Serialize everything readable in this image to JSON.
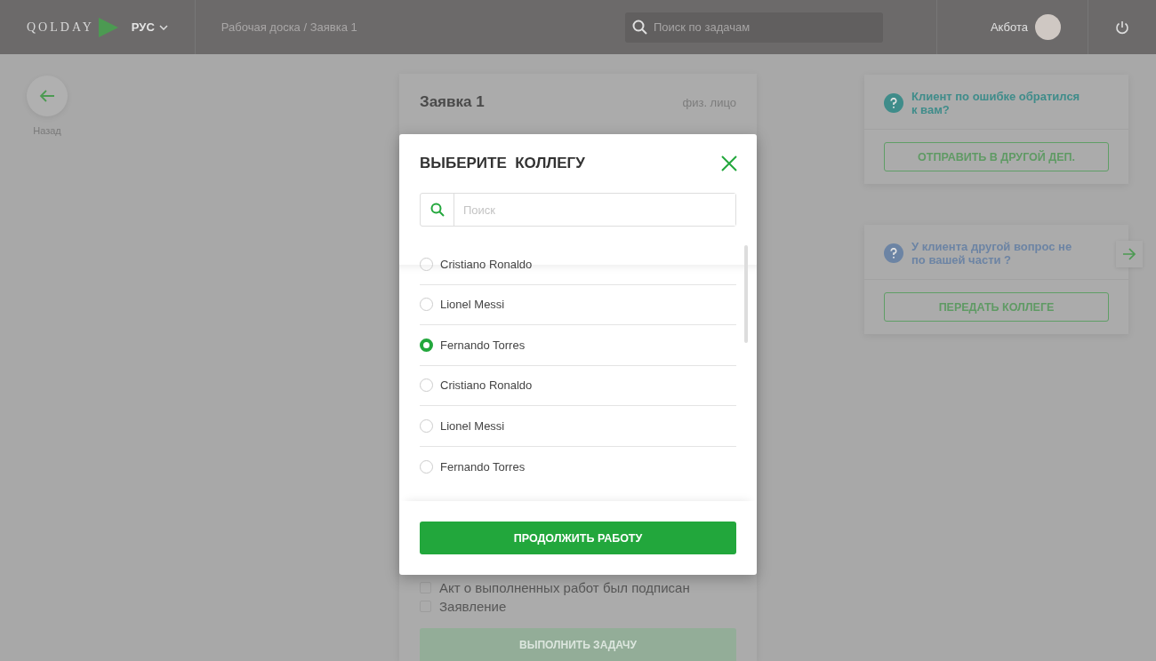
{
  "header": {
    "logo": "QOLDAY",
    "language": "РУС",
    "breadcrumb": "Рабочая доска / Заявка 1",
    "search": {
      "placeholder": "Поиск по задачам"
    },
    "user": "Акбота"
  },
  "back": {
    "label": "Назад"
  },
  "task": {
    "title": "Заявка 1",
    "type": "физ. лицо",
    "checklist": [
      {
        "label": "Акт о выполненных работ был подписан",
        "checked": false
      },
      {
        "label": "Заявление",
        "checked": false
      }
    ],
    "action": {
      "label": "ВЫПОЛНИТЬ ЗАДАЧУ",
      "disabled": true
    }
  },
  "side_cards": [
    {
      "question": "Клиент по ошибке обратился к вам?",
      "button": "ОТПРАВИТЬ В ДРУГОЙ ДЕП.",
      "color": "#3f8c8a",
      "next": false
    },
    {
      "question": "У клиента другой вопрос не по вашей части ?",
      "button": "ПЕРЕДАТЬ КОЛЛЕГЕ",
      "color": "#6c84a4",
      "next": true
    }
  ],
  "modal": {
    "title": "ВЫБЕРИТЕ  КОЛЛЕГУ",
    "search": {
      "placeholder": "Поиск"
    },
    "colleagues": [
      {
        "name": "Cristiano Ronaldo",
        "selected": false
      },
      {
        "name": "Lionel Messi",
        "selected": false
      },
      {
        "name": "Fernando Torres",
        "selected": true
      },
      {
        "name": "Cristiano Ronaldo",
        "selected": false
      },
      {
        "name": "Lionel Messi",
        "selected": false
      },
      {
        "name": "Fernando Torres",
        "selected": false
      }
    ],
    "confirm": "ПРОДОЛЖИТЬ РАБОТУ"
  }
}
